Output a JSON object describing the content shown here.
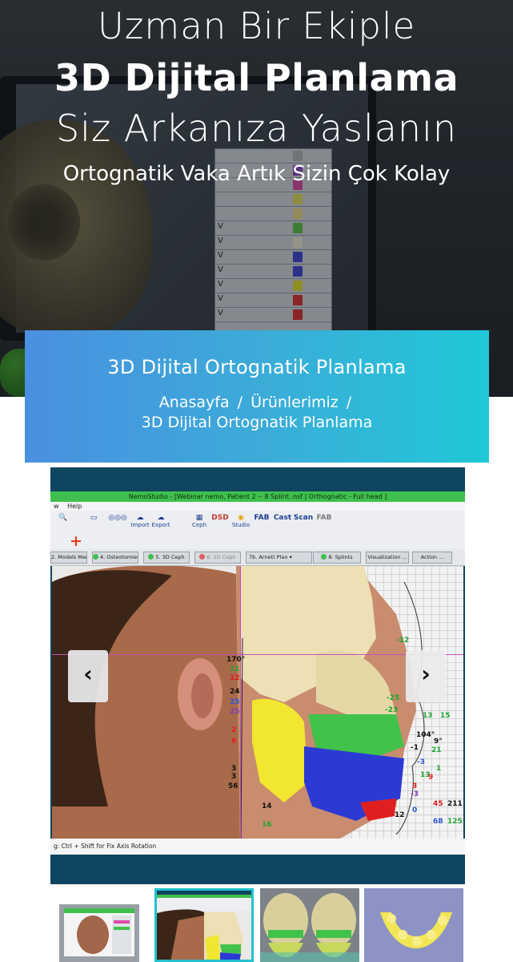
{
  "hero": {
    "line1": "Uzman Bir Ekiple",
    "line2": "3D Dijital Planlama",
    "line3": "Siz Arkanıza Yaslanın",
    "line4": "Ortognatik Vaka Artık Sizin Çok Kolay"
  },
  "banner": {
    "title": "3D Dijital Ortognatik Planlama",
    "breadcrumb": [
      "Anasayfa",
      "Ürünlerimiz",
      "3D Dijital Ortognatik Planlama"
    ],
    "separator": "/"
  },
  "slider": {
    "app_title": "NemoStudio - [Webinar nemo, Patient 2 -- 8 Splint .nsf | Orthognatic - Full head ]",
    "menu": [
      "w",
      "Help"
    ],
    "toolbar_buttons": [
      "Import",
      "Export",
      "Ceph",
      "DSD",
      "Studio",
      "FAB",
      "Cast",
      "Scan",
      "FAB"
    ],
    "steps": [
      "2. Models Merge",
      "4. Osteotomies",
      "5. 3D Ceph",
      "6. 2D Ceph",
      "7b. Arnett Plan",
      "8. Splints",
      "Visualization ...",
      "Action ..."
    ],
    "status_text": "g: Ctrl + Shift for Fix Axis Rotation",
    "measurements": {
      "left_column": [
        "170°",
        "11",
        "12",
        "24",
        "25",
        "25",
        "2",
        "6",
        "3",
        "3",
        "56"
      ],
      "right_top": "-12",
      "right_side": [
        "-25",
        "-23",
        "13",
        "15",
        "104°",
        "9°",
        "21",
        "-1",
        "-3",
        "1",
        "13",
        "9",
        "3",
        "45",
        "211",
        "68",
        "125",
        "12",
        "0",
        "-3"
      ],
      "bottom": [
        "14",
        "16"
      ]
    },
    "prev_label": "‹",
    "next_label": "›"
  },
  "thumbnails": [
    {
      "name": "thumb-1",
      "active": false
    },
    {
      "name": "thumb-2",
      "active": true
    },
    {
      "name": "thumb-3",
      "active": false
    },
    {
      "name": "thumb-4",
      "active": false
    }
  ],
  "colors": {
    "banner_start": "#4a8fe0",
    "banner_end": "#1fc8d8",
    "active_thumb": "#22c1cf",
    "slider_bg": "#0f4560"
  }
}
